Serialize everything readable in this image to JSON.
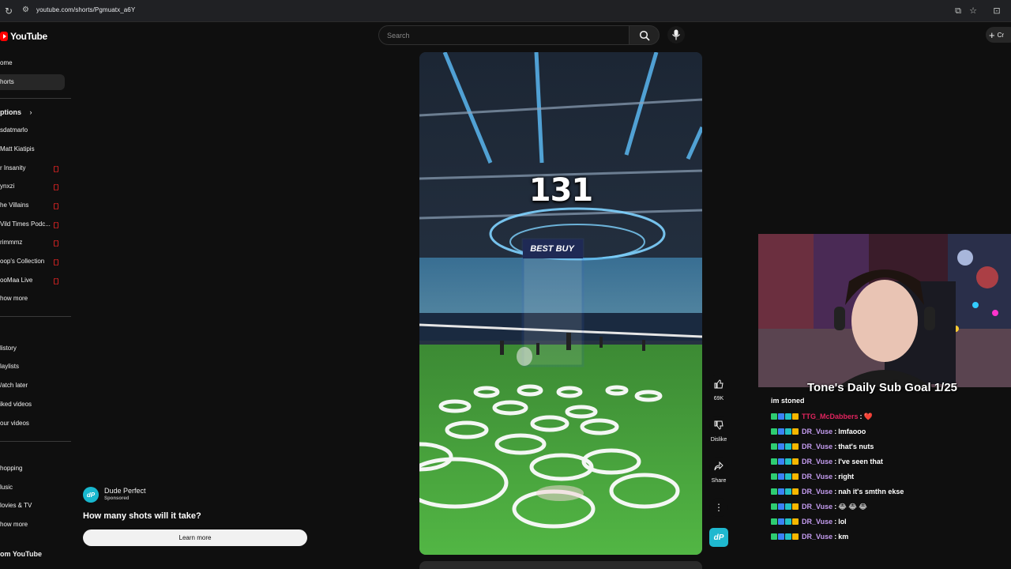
{
  "browser": {
    "url": "youtube.com/shorts/Pgmuatx_a6Y"
  },
  "header": {
    "logo_text": "YouTube",
    "search_placeholder": "Search",
    "create_label": "Cr"
  },
  "sidebar": {
    "primary": [
      {
        "label": "ome"
      },
      {
        "label": "horts"
      }
    ],
    "subscriptions_heading": "ptions",
    "subscriptions": [
      {
        "label": "sdatmarlo",
        "live": false
      },
      {
        "label": "Matt Kiatipis",
        "live": false
      },
      {
        "label": "r Insanity",
        "live": true
      },
      {
        "label": "ynxzi",
        "live": true
      },
      {
        "label": "he Villains",
        "live": true
      },
      {
        "label": "Vild Times Podc...",
        "live": true
      },
      {
        "label": "rimmmz",
        "live": true
      },
      {
        "label": "oop's Collection",
        "live": true
      },
      {
        "label": "ooMaa Live",
        "live": true
      },
      {
        "label": "how more",
        "live": false
      }
    ],
    "you": [
      {
        "label": "listory"
      },
      {
        "label": "laylists"
      },
      {
        "label": "/atch later"
      },
      {
        "label": "iked videos"
      },
      {
        "label": "our videos"
      }
    ],
    "explore": [
      {
        "label": "hopping"
      },
      {
        "label": "lusic"
      },
      {
        "label": "lovies & TV"
      },
      {
        "label": "how more"
      }
    ],
    "more_heading": "om YouTube"
  },
  "ad": {
    "avatar_text": "dP",
    "channel": "Dude Perfect",
    "sponsored": "Sponsored",
    "title": "How many shots will it take?",
    "cta": "Learn more"
  },
  "video": {
    "counter": "131",
    "sign": "BEST BUY"
  },
  "actions": {
    "like_count": "69K",
    "dislike_label": "Dislike",
    "share_label": "Share",
    "channel_initials": "dP"
  },
  "stream_overlay": {
    "sub_goal": "Tone's Daily Sub Goal 1/25",
    "chat_header": "im stoned",
    "chat": [
      {
        "user": "TTG_McDabbers",
        "message": "❤️",
        "user_color": "#e0245e"
      },
      {
        "user": "DR_Vuse",
        "message": "lmfaooo",
        "user_color": "#c49cf0"
      },
      {
        "user": "DR_Vuse",
        "message": "that's nuts",
        "user_color": "#c49cf0"
      },
      {
        "user": "DR_Vuse",
        "message": "I've seen that",
        "user_color": "#c49cf0"
      },
      {
        "user": "DR_Vuse",
        "message": "right",
        "user_color": "#c49cf0"
      },
      {
        "user": "DR_Vuse",
        "message": "nah it's smthn ekse",
        "user_color": "#c49cf0"
      },
      {
        "user": "DR_Vuse",
        "message": "😂 😂 😂",
        "user_color": "#c49cf0"
      },
      {
        "user": "DR_Vuse",
        "message": "lol",
        "user_color": "#c49cf0"
      },
      {
        "user": "DR_Vuse",
        "message": "km",
        "user_color": "#c49cf0"
      }
    ]
  },
  "colors": {
    "background": "#0f0f0f",
    "youtube_red": "#ff0000",
    "turf_green": "#46a83a",
    "dude_perfect_teal": "#1fb8cf"
  }
}
